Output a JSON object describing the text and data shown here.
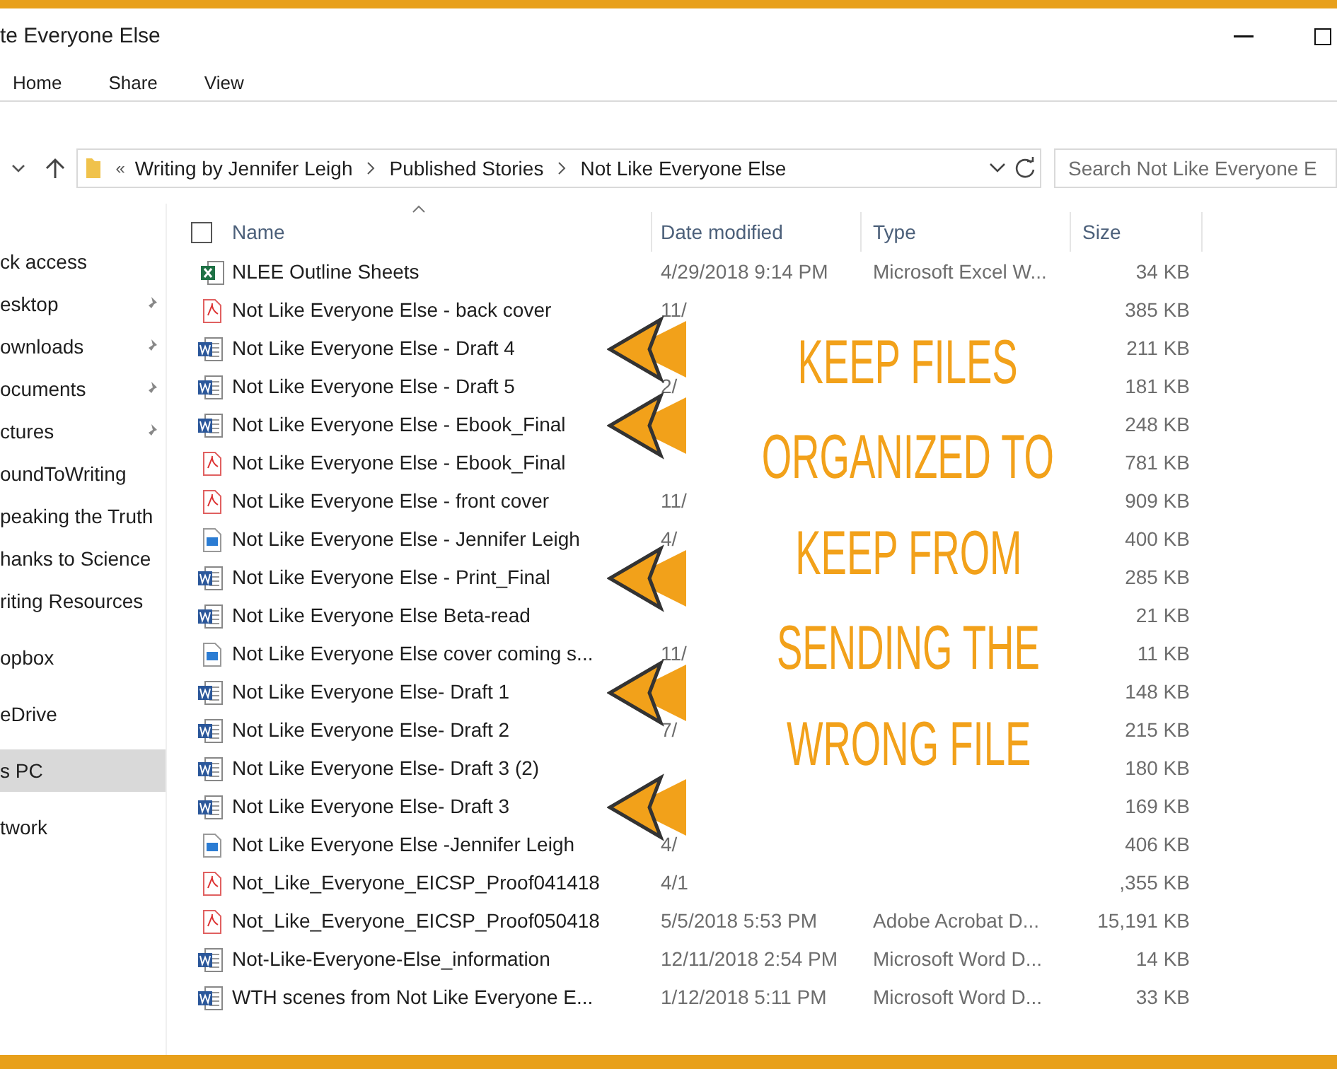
{
  "window": {
    "title": "te Everyone Else"
  },
  "ribbon_tabs": [
    "Home",
    "Share",
    "View"
  ],
  "address_bar": {
    "overflow": "«",
    "path": [
      "Writing by Jennifer Leigh",
      "Published Stories",
      "Not Like Everyone Else"
    ]
  },
  "search": {
    "placeholder": "Search Not Like Everyone E"
  },
  "sidebar": {
    "groups": [
      {
        "items": [
          {
            "label": "ck access",
            "pinned": false,
            "selected": false
          },
          {
            "label": "esktop",
            "pinned": true,
            "selected": false
          },
          {
            "label": "ownloads",
            "pinned": true,
            "selected": false
          },
          {
            "label": "ocuments",
            "pinned": true,
            "selected": false
          },
          {
            "label": "ctures",
            "pinned": true,
            "selected": false
          },
          {
            "label": "oundToWriting",
            "pinned": false,
            "selected": false
          },
          {
            "label": "peaking the Truth",
            "pinned": false,
            "selected": false
          },
          {
            "label": "hanks to Science",
            "pinned": false,
            "selected": false
          },
          {
            "label": "riting Resources",
            "pinned": false,
            "selected": false
          }
        ]
      },
      {
        "items": [
          {
            "label": "opbox",
            "pinned": false,
            "selected": false
          }
        ]
      },
      {
        "items": [
          {
            "label": "eDrive",
            "pinned": false,
            "selected": false
          }
        ]
      },
      {
        "items": [
          {
            "label": "s PC",
            "pinned": false,
            "selected": true
          }
        ]
      },
      {
        "items": [
          {
            "label": "twork",
            "pinned": false,
            "selected": false
          }
        ]
      }
    ]
  },
  "table": {
    "select_all": {
      "checked": false
    },
    "columns": [
      "Name",
      "Date modified",
      "Type",
      "Size"
    ],
    "rows": [
      {
        "kind": "excel",
        "name": "NLEE Outline Sheets",
        "date": "4/29/2018 9:14 PM",
        "type": "Microsoft Excel W...",
        "size": "34 KB",
        "arrow": false
      },
      {
        "kind": "pdf",
        "name": "Not Like Everyone Else - back cover",
        "date": "11/",
        "size": "385 KB",
        "arrow": false
      },
      {
        "kind": "word",
        "name": "Not Like Everyone Else - Draft 4",
        "size": "211 KB",
        "arrow": true
      },
      {
        "kind": "word",
        "name": "Not Like Everyone Else - Draft 5",
        "date": "2/",
        "size": "181 KB",
        "arrow": false
      },
      {
        "kind": "word",
        "name": "Not Like Everyone Else - Ebook_Final",
        "size": "248 KB",
        "arrow": true
      },
      {
        "kind": "pdf",
        "name": "Not Like Everyone Else - Ebook_Final",
        "size": "781 KB",
        "arrow": false
      },
      {
        "kind": "pdf",
        "name": "Not Like Everyone Else - front cover",
        "date": "11/",
        "size": "909 KB",
        "arrow": false
      },
      {
        "kind": "image",
        "name": "Not Like Everyone Else - Jennifer Leigh",
        "date": "4/",
        "size": "400 KB",
        "arrow": false
      },
      {
        "kind": "word",
        "name": "Not Like Everyone Else - Print_Final",
        "size": "285 KB",
        "arrow": true
      },
      {
        "kind": "word",
        "name": "Not Like Everyone Else Beta-read",
        "size": "21 KB",
        "arrow": false
      },
      {
        "kind": "image",
        "name": "Not Like Everyone Else cover coming s...",
        "date": "11/",
        "size": "11 KB",
        "arrow": false
      },
      {
        "kind": "word",
        "name": "Not Like Everyone Else- Draft 1",
        "size": "148 KB",
        "arrow": true
      },
      {
        "kind": "word",
        "name": "Not Like Everyone Else- Draft 2",
        "date": "7/",
        "size": "215 KB",
        "arrow": false
      },
      {
        "kind": "word",
        "name": "Not Like Everyone Else- Draft 3 (2)",
        "size": "180 KB",
        "arrow": false
      },
      {
        "kind": "word",
        "name": "Not Like Everyone Else- Draft 3",
        "size": "169 KB",
        "arrow": true
      },
      {
        "kind": "image",
        "name": "Not Like Everyone Else -Jennifer Leigh",
        "date": "4/",
        "size": "406 KB",
        "arrow": false
      },
      {
        "kind": "pdf",
        "name": "Not_Like_Everyone_EICSP_Proof041418",
        "date": "4/1",
        "size": ",355 KB",
        "arrow": false
      },
      {
        "kind": "pdf",
        "name": "Not_Like_Everyone_EICSP_Proof050418",
        "date": "5/5/2018 5:53 PM",
        "type": "Adobe Acrobat D...",
        "size": "15,191 KB",
        "arrow": false
      },
      {
        "kind": "word",
        "name": "Not-Like-Everyone-Else_information",
        "date": "12/11/2018 2:54 PM",
        "type": "Microsoft Word D...",
        "size": "14 KB",
        "arrow": false
      },
      {
        "kind": "word",
        "name": "WTH scenes from Not Like Everyone E...",
        "date": "1/12/2018 5:11 PM",
        "type": "Microsoft Word D...",
        "size": "33 KB",
        "arrow": false
      }
    ]
  },
  "overlay": {
    "lines": [
      "KEEP FILES",
      "ORGANIZED TO",
      "KEEP FROM",
      "SENDING THE",
      "WRONG FILE"
    ]
  }
}
